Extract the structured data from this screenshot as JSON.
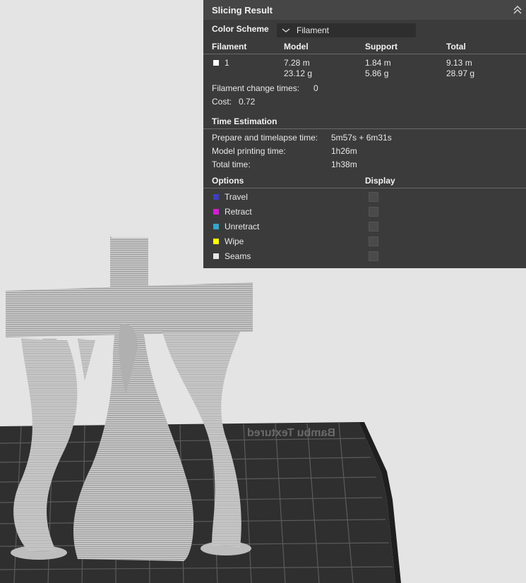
{
  "panel": {
    "title": "Slicing Result",
    "color_scheme_label": "Color Scheme",
    "color_scheme_value": "Filament",
    "filament_table": {
      "headers": [
        "Filament",
        "Model",
        "Support",
        "Total"
      ],
      "row": {
        "filament": "1",
        "model_length": "7.28 m",
        "model_weight": "23.12 g",
        "support_length": "1.84 m",
        "support_weight": "5.86 g",
        "total_length": "9.13 m",
        "total_weight": "28.97 g",
        "swatch_color": "#ffffff"
      }
    },
    "filament_change_label": "Filament change times:",
    "filament_change_value": "0",
    "cost_label": "Cost:",
    "cost_value": "0.72",
    "time_heading": "Time Estimation",
    "times": [
      {
        "label": "Prepare and timelapse time:",
        "value": "5m57s + 6m31s"
      },
      {
        "label": "Model printing time:",
        "value": "1h26m"
      },
      {
        "label": "Total time:",
        "value": "1h38m"
      }
    ],
    "options_heading": "Options",
    "display_heading": "Display",
    "options": [
      {
        "label": "Travel",
        "color": "#3f3fbf",
        "checked": false
      },
      {
        "label": "Retract",
        "color": "#d21ed2",
        "checked": false
      },
      {
        "label": "Unretract",
        "color": "#3ba3c9",
        "checked": false
      },
      {
        "label": "Wipe",
        "color": "#ffff00",
        "checked": false
      },
      {
        "label": "Seams",
        "color": "#e6e6e6",
        "checked": false
      }
    ]
  },
  "plate": {
    "label": "Bambu Textured"
  }
}
